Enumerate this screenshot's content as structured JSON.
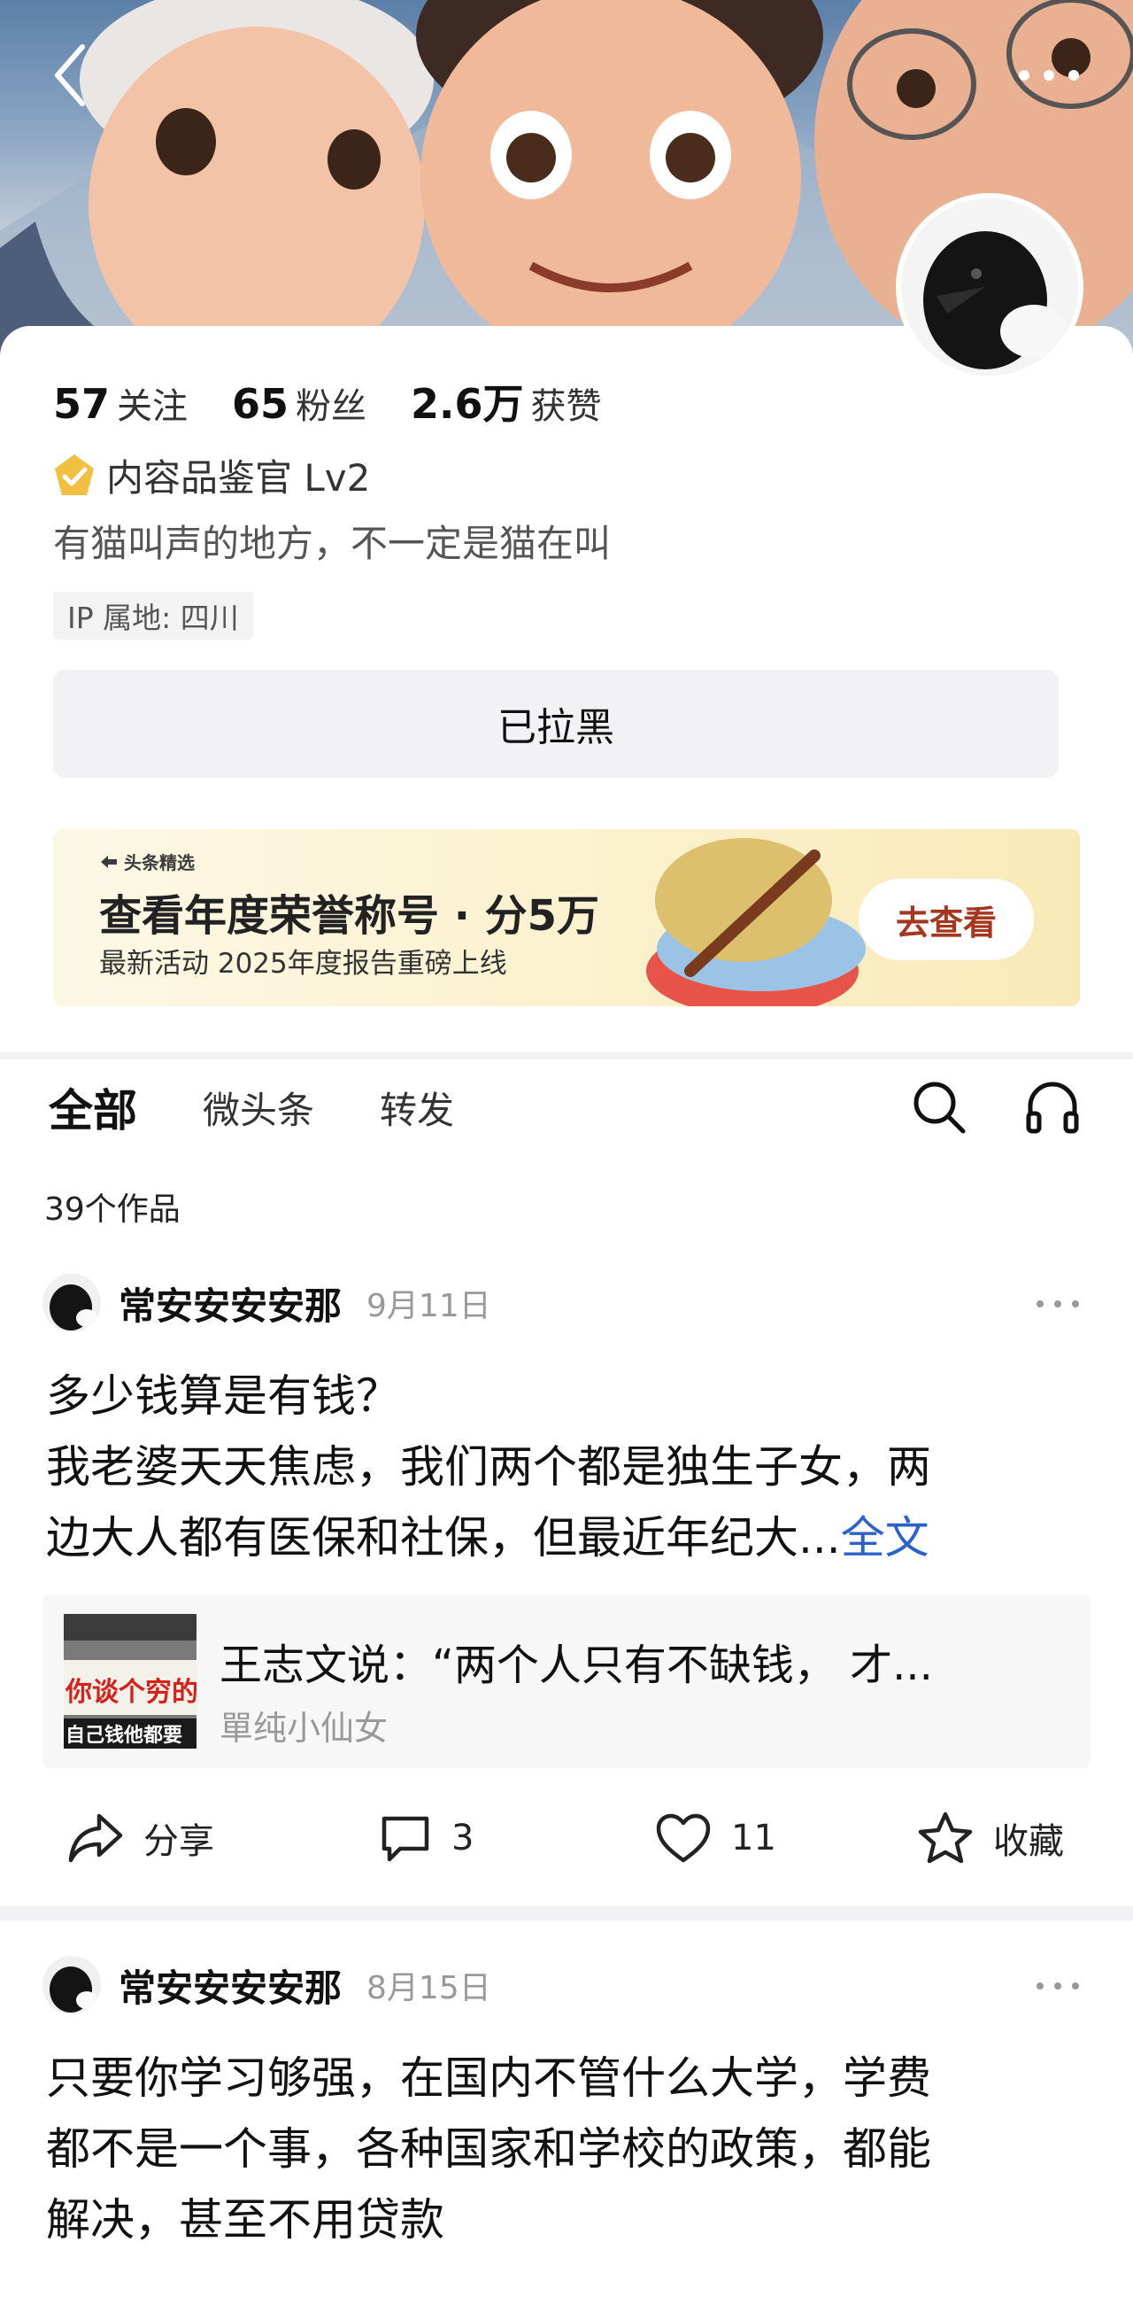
{
  "header": {
    "back_icon": "chevron-left-icon",
    "more_icon": "more-horizontal-icon"
  },
  "profile": {
    "stats": [
      {
        "num": "57",
        "label": "关注"
      },
      {
        "num": "65",
        "label": "粉丝"
      },
      {
        "num": "2.6万",
        "label": "获赞"
      }
    ],
    "title": "内容品鉴官 Lv2",
    "bio": "有猫叫声的地方，不一定是猫在叫",
    "ip": "IP 属地: 四川",
    "blocked_label": "已拉黑"
  },
  "banner": {
    "brand": "头条精选",
    "title": "查看年度荣誉称号 · 分5万",
    "subtitle": "最新活动 2025年度报告重磅上线",
    "cta": "去查看"
  },
  "tabs": {
    "items": [
      "全部",
      "微头条",
      "转发"
    ],
    "active": "全部"
  },
  "works_count": "39个作品",
  "posts": [
    {
      "author": "常安安安安那",
      "date": "9月11日",
      "text_line1": "多少钱算是有钱？",
      "text_line2": "我老婆天天焦虑，我们两个都是独生子女，两",
      "text_line3": "边大人都有医保和社保，但最近年纪大...",
      "fulltext_label": "全文",
      "quote": {
        "title": "王志文说：“两个人只有不缺钱， 才...",
        "author": "單纯小仙女",
        "thumb_text1": "你谈个穷的",
        "thumb_text2": "自己钱他都要"
      },
      "actions": {
        "share": "分享",
        "comments": "3",
        "likes": "11",
        "collect": "收藏"
      }
    },
    {
      "author": "常安安安安那",
      "date": "8月15日",
      "text_line1": "只要你学习够强，在国内不管什么大学，学费",
      "text_line2": "都不是一个事，各种国家和学校的政策，都能",
      "text_line3": "解决，甚至不用贷款"
    }
  ],
  "colors": {
    "link": "#2a62c9",
    "cta_text": "#a6371f",
    "badge": "#f1c040"
  }
}
